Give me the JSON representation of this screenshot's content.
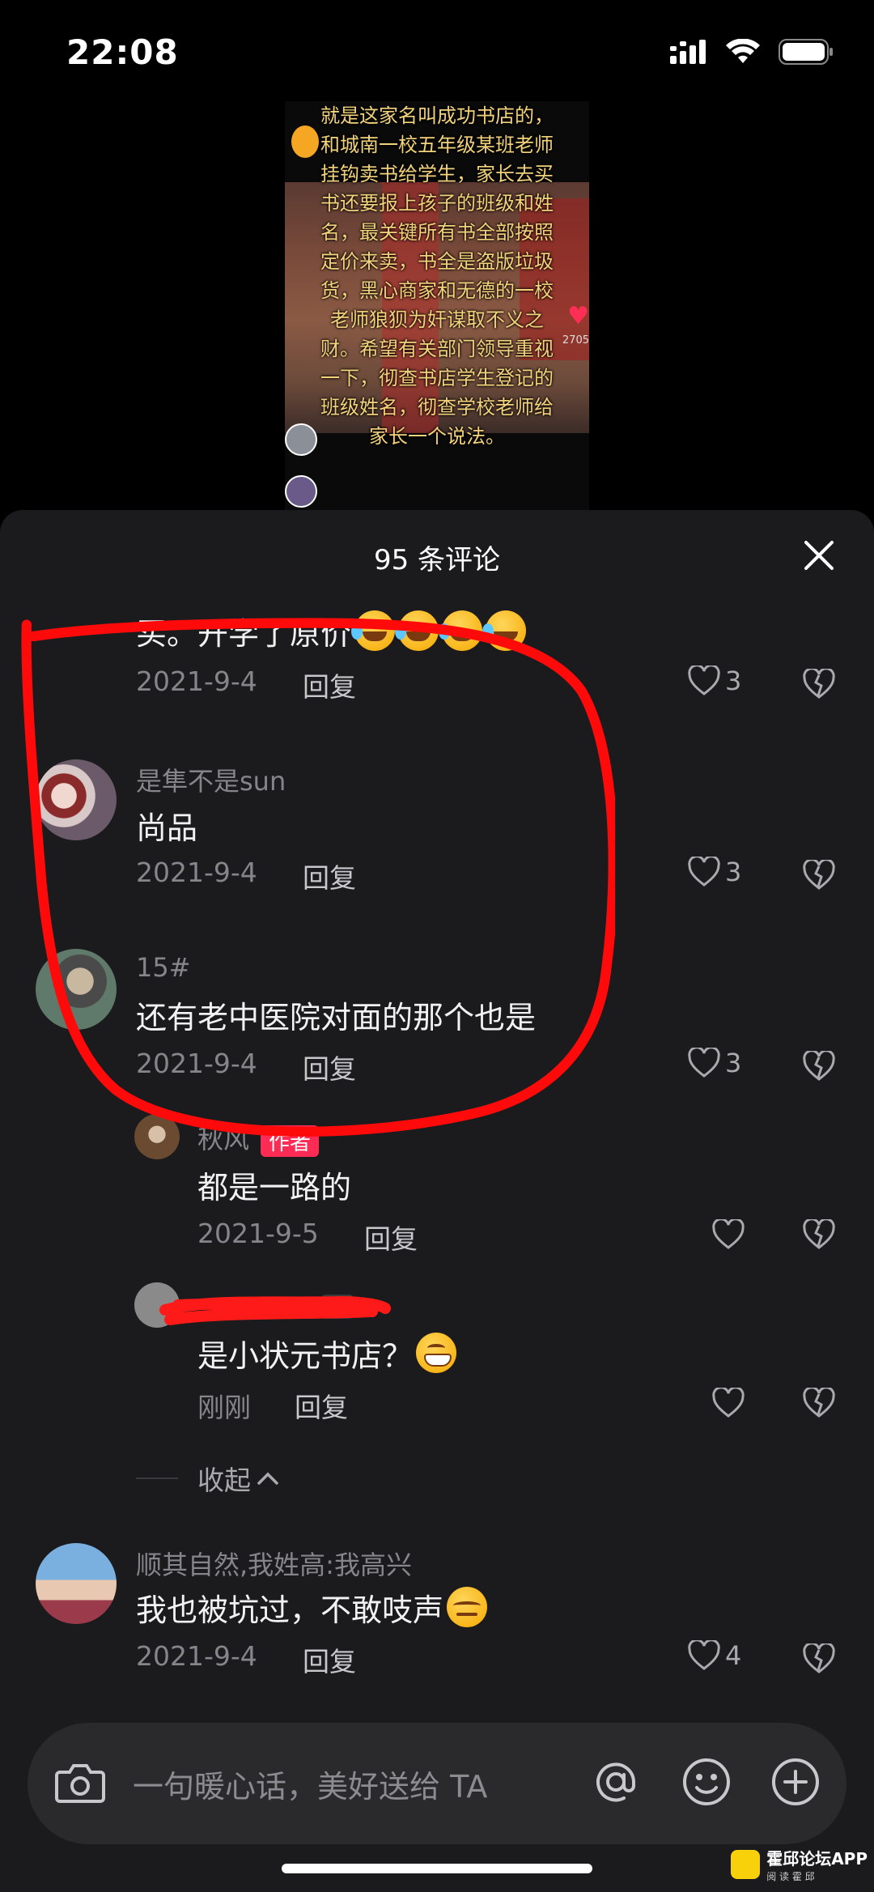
{
  "status_bar": {
    "time": "22:08"
  },
  "video": {
    "caption": "就是这家名叫成功书店的，\n和城南一校五年级某班老师\n挂钩卖书给学生，家长去买\n书还要报上孩子的班级和姓\n名，最关键所有书全部按照\n定价来卖，书全是盗版垃圾\n货，黑心商家和无德的一校\n老师狼狈为奸谋取不义之\n财。希望有关部门领导重视\n一下，彻查书店学生登记的\n班级姓名，彻查学校老师给\n家长一个说法。",
    "like_count": "2705"
  },
  "sheet": {
    "title": "95 条评论"
  },
  "comments": [
    {
      "username": "",
      "text": "买。开学了原价",
      "date": "2021-9-4",
      "reply": "回复",
      "likes": "3"
    },
    {
      "username": "是隼不是sun",
      "text": "尚品",
      "date": "2021-9-4",
      "reply": "回复",
      "likes": "3"
    },
    {
      "username": "15#",
      "text": "还有老中医院对面的那个也是",
      "date": "2021-9-4",
      "reply": "回复",
      "likes": "3"
    },
    {
      "username": "秋风",
      "badge": "作者",
      "text": "都是一路的",
      "date": "2021-9-5",
      "reply": "回复",
      "likes": ""
    },
    {
      "username": "我",
      "text": "是小状元书店？",
      "date": "刚刚",
      "reply": "回复",
      "likes": ""
    },
    {
      "username": "顺其自然,我姓高:我高兴",
      "text": "我也被坑过，不敢吱声",
      "date": "2021-9-4",
      "reply": "回复",
      "likes": "4"
    }
  ],
  "collapse": {
    "label": "收起"
  },
  "input": {
    "placeholder": "一句暖心话，美好送给 TA"
  },
  "watermark": {
    "title": "霍邱论坛APP",
    "subtitle": "阅 读 霍 邱"
  },
  "colors": {
    "accent": "#fe2c55",
    "sheet_bg": "#1b1b1d",
    "annotation": "#ff0000"
  }
}
